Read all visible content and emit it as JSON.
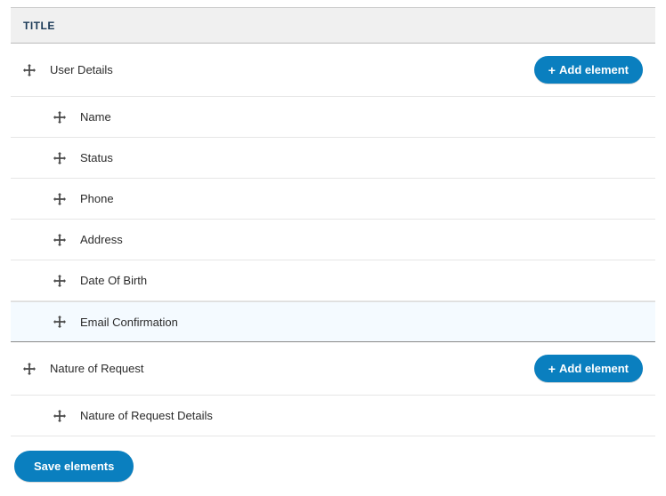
{
  "header": {
    "column_title": "TITLE"
  },
  "buttons": {
    "add_element": "Add element",
    "save_elements": "Save elements"
  },
  "sections": [
    {
      "label": "User Details",
      "children": [
        {
          "label": "Name"
        },
        {
          "label": "Status"
        },
        {
          "label": "Phone"
        },
        {
          "label": "Address"
        },
        {
          "label": "Date Of Birth"
        },
        {
          "label": "Email Confirmation",
          "highlight": true
        }
      ]
    },
    {
      "label": "Nature of Request",
      "children": [
        {
          "label": "Nature of Request Details"
        }
      ]
    }
  ]
}
